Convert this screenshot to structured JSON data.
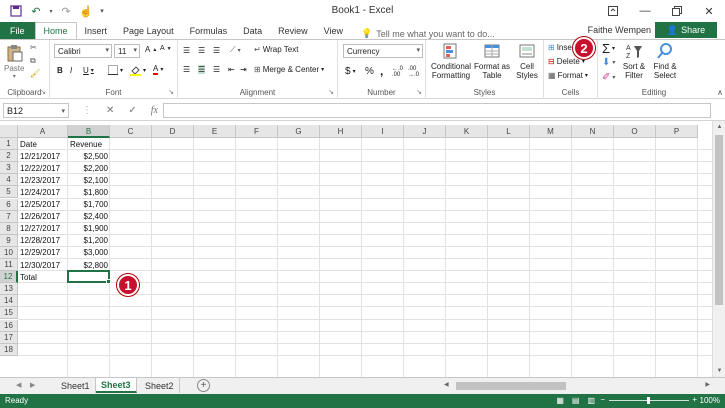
{
  "window": {
    "title": "Book1 - Excel",
    "user_name": "Faithe Wempen",
    "share_label": "Share"
  },
  "tabs": [
    "File",
    "Home",
    "Insert",
    "Page Layout",
    "Formulas",
    "Data",
    "Review",
    "View"
  ],
  "active_tab": "Home",
  "tell_me": "Tell me what you want to do...",
  "ribbon": {
    "clipboard": {
      "label": "Clipboard",
      "paste_label": "Paste"
    },
    "font": {
      "label": "Font",
      "font_name": "Calibri",
      "font_size": "11"
    },
    "alignment": {
      "label": "Alignment",
      "wrap_text": "Wrap Text",
      "merge_center": "Merge & Center"
    },
    "number": {
      "label": "Number",
      "format": "Currency",
      "currency_symbol": "$",
      "percent_symbol": "%",
      "comma_symbol": ","
    },
    "styles": {
      "label": "Styles",
      "conditional_formatting": [
        "Conditional",
        "Formatting"
      ],
      "format_as_table": [
        "Format as",
        "Table"
      ],
      "cell_styles": [
        "Cell",
        "Styles"
      ]
    },
    "cells": {
      "label": "Cells",
      "insert": "Insert",
      "delete": "Delete",
      "format": "Format"
    },
    "editing": {
      "label": "Editing",
      "sort_filter": [
        "Sort &",
        "Filter"
      ],
      "find_select": [
        "Find &",
        "Select"
      ]
    }
  },
  "formula_bar": {
    "name_box": "B12",
    "cancel": "✕",
    "enter": "✓",
    "fx": "fx",
    "value": ""
  },
  "columns": [
    "A",
    "B",
    "C",
    "D",
    "E",
    "F",
    "G",
    "H",
    "I",
    "J",
    "K",
    "L",
    "M",
    "N",
    "O",
    "P"
  ],
  "rows": [
    "1",
    "2",
    "3",
    "4",
    "5",
    "6",
    "7",
    "8",
    "9",
    "10",
    "11",
    "12",
    "13",
    "14",
    "15",
    "16",
    "17",
    "18"
  ],
  "selected_cell": "B12",
  "table": {
    "headers": [
      "Date",
      "Revenue"
    ],
    "rows": [
      [
        "12/21/2017",
        "$2,500"
      ],
      [
        "12/22/2017",
        "$2,200"
      ],
      [
        "12/23/2017",
        "$2,100"
      ],
      [
        "12/24/2017",
        "$1,800"
      ],
      [
        "12/25/2017",
        "$1,700"
      ],
      [
        "12/26/2017",
        "$2,400"
      ],
      [
        "12/27/2017",
        "$1,900"
      ],
      [
        "12/28/2017",
        "$1,200"
      ],
      [
        "12/29/2017",
        "$3,000"
      ],
      [
        "12/30/2017",
        "$2,800"
      ]
    ],
    "total_label": "Total"
  },
  "sheets": [
    "Sheet1",
    "Sheet3",
    "Sheet2"
  ],
  "active_sheet": "Sheet3",
  "status": {
    "ready": "Ready",
    "zoom": "100%"
  },
  "callouts": [
    "1",
    "2"
  ],
  "colors": {
    "accent": "#217346",
    "callout": "#c8102e"
  }
}
